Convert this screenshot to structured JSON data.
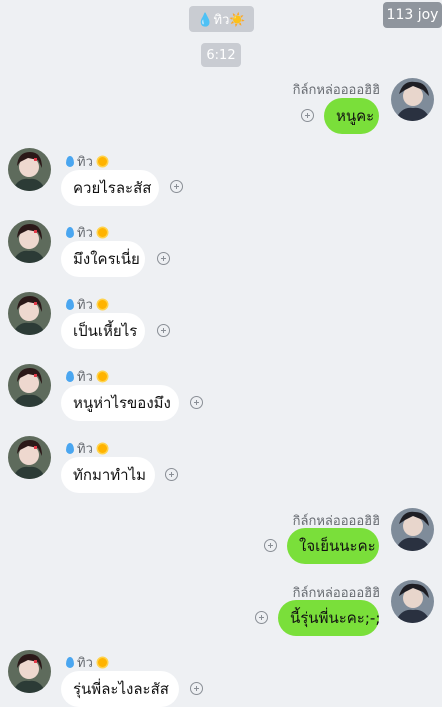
{
  "header": {
    "top_label": "💧ทิว☀️",
    "counter": "113 joy",
    "time": "6:12"
  },
  "sender_self": "กิล์กหล่ออออฮิฮิ",
  "sender_other": "ทิว",
  "messages": [
    {
      "text": "หนูคะ"
    },
    {
      "text": "ควยไรละสัส"
    },
    {
      "text": "มึงใครเนี่ย"
    },
    {
      "text": "เป็นเหี้ยไร"
    },
    {
      "text": "หนูห่าไรของมึง"
    },
    {
      "text": "ทักมาทำไม"
    },
    {
      "text": "ใจเย็นนะคะ"
    },
    {
      "text": "นี้รุ่นพี่นะคะ;-;"
    },
    {
      "text": "รุ่นพี่ละไงละสัส"
    }
  ],
  "colors": {
    "background": "#eef0f3",
    "outgoing_bubble": "#7adf3a",
    "incoming_bubble": "#ffffff"
  }
}
